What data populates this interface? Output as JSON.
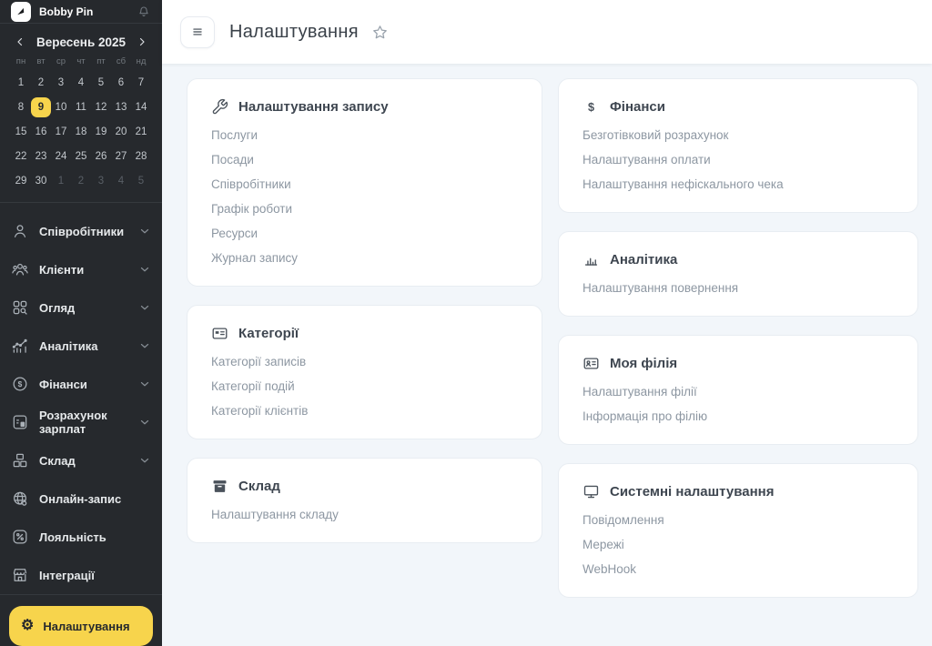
{
  "colors": {
    "accent": "#f7d44c",
    "sidebar_bg": "#26292d",
    "content_bg": "#f2f6fa",
    "card_bg": "#ffffff"
  },
  "sidebar": {
    "brand": "Bobby Pin",
    "calendar": {
      "month_label": "Вересень 2025",
      "weekdays": [
        "пн",
        "вт",
        "ср",
        "чт",
        "пт",
        "сб",
        "нд"
      ],
      "cells": [
        {
          "d": "1"
        },
        {
          "d": "2"
        },
        {
          "d": "3"
        },
        {
          "d": "4"
        },
        {
          "d": "5"
        },
        {
          "d": "6"
        },
        {
          "d": "7"
        },
        {
          "d": "8"
        },
        {
          "d": "9",
          "selected": true
        },
        {
          "d": "10"
        },
        {
          "d": "11"
        },
        {
          "d": "12"
        },
        {
          "d": "13"
        },
        {
          "d": "14"
        },
        {
          "d": "15"
        },
        {
          "d": "16"
        },
        {
          "d": "17"
        },
        {
          "d": "18"
        },
        {
          "d": "19"
        },
        {
          "d": "20"
        },
        {
          "d": "21"
        },
        {
          "d": "22"
        },
        {
          "d": "23"
        },
        {
          "d": "24"
        },
        {
          "d": "25"
        },
        {
          "d": "26"
        },
        {
          "d": "27"
        },
        {
          "d": "28"
        },
        {
          "d": "29"
        },
        {
          "d": "30"
        },
        {
          "d": "1",
          "muted": true
        },
        {
          "d": "2",
          "muted": true
        },
        {
          "d": "3",
          "muted": true
        },
        {
          "d": "4",
          "muted": true
        },
        {
          "d": "5",
          "muted": true
        }
      ]
    },
    "items": [
      {
        "id": "employees",
        "label": "Співробітники",
        "icon": "user-icon",
        "expandable": true
      },
      {
        "id": "clients",
        "label": "Клієнти",
        "icon": "users-icon",
        "expandable": true
      },
      {
        "id": "overview",
        "label": "Огляд",
        "icon": "overview-icon",
        "expandable": true
      },
      {
        "id": "analytics",
        "label": "Аналітика",
        "icon": "analytics-icon",
        "expandable": true
      },
      {
        "id": "finance",
        "label": "Фінанси",
        "icon": "finance-icon",
        "expandable": true
      },
      {
        "id": "payroll",
        "label": "Розрахунок зарплат",
        "icon": "payroll-icon",
        "expandable": true
      },
      {
        "id": "warehouse",
        "label": "Склад",
        "icon": "warehouse-icon",
        "expandable": true
      },
      {
        "id": "online-booking",
        "label": "Онлайн-запис",
        "icon": "online-booking-icon",
        "expandable": false
      },
      {
        "id": "loyalty",
        "label": "Лояльність",
        "icon": "loyalty-icon",
        "expandable": false
      },
      {
        "id": "integrations",
        "label": "Інтеграції",
        "icon": "integrations-icon",
        "expandable": false
      }
    ],
    "active_item": {
      "label": "Налаштування",
      "icon": "gear-icon"
    }
  },
  "header": {
    "title": "Налаштування"
  },
  "cards": {
    "left": [
      {
        "id": "record-settings",
        "title": "Налаштування запису",
        "icon": "wrench-icon",
        "links": [
          "Послуги",
          "Посади",
          "Співробітники",
          "Графік роботи",
          "Ресурси",
          "Журнал запису"
        ]
      },
      {
        "id": "categories",
        "title": "Категорії",
        "icon": "id-card-icon",
        "links": [
          "Категорії записів",
          "Категорії подій",
          "Категорії клієнтів"
        ]
      },
      {
        "id": "warehouse",
        "title": "Склад",
        "icon": "archive-icon",
        "links": [
          "Налаштування складу"
        ]
      }
    ],
    "right": [
      {
        "id": "finance",
        "title": "Фінанси",
        "icon": "dollar-icon",
        "links": [
          "Безготівковий розрахунок",
          "Налаштування оплати",
          "Налаштування нефіскального чека"
        ]
      },
      {
        "id": "analytics",
        "title": "Аналітика",
        "icon": "bar-chart-icon",
        "links": [
          "Налаштування повернення"
        ]
      },
      {
        "id": "my-branch",
        "title": "Моя філія",
        "icon": "id-badge-icon",
        "links": [
          "Налаштування філії",
          "Інформація про філію"
        ]
      },
      {
        "id": "system",
        "title": "Системні налаштування",
        "icon": "monitor-icon",
        "links": [
          "Повідомлення",
          "Мережі",
          "WebHook"
        ]
      }
    ]
  }
}
